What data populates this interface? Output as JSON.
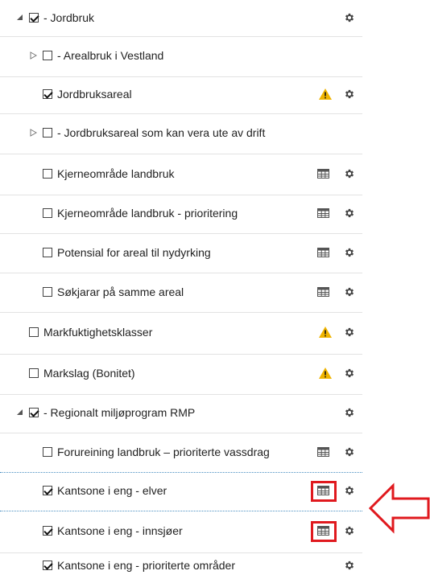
{
  "layers": [
    {
      "label": "- Jordbruk",
      "checked": true,
      "expander": "expanded",
      "table": false,
      "warn": false
    },
    {
      "label": "- Arealbruk i Vestland",
      "checked": false,
      "expander": "collapsed",
      "table": false,
      "warn": false,
      "gear": false
    },
    {
      "label": "Jordbruksareal",
      "checked": true,
      "expander": "none",
      "table": false,
      "warn": true
    },
    {
      "label": "- Jordbruksareal som kan vera ute av drift",
      "checked": false,
      "expander": "collapsed",
      "table": false,
      "warn": false,
      "gear": false
    },
    {
      "label": "Kjerneområde landbruk",
      "checked": false,
      "expander": "none",
      "table": true,
      "warn": false
    },
    {
      "label": "Kjerneområde landbruk - prioritering",
      "checked": false,
      "expander": "none",
      "table": true,
      "warn": false
    },
    {
      "label": "Potensial for areal til nydyrking",
      "checked": false,
      "expander": "none",
      "table": true,
      "warn": false
    },
    {
      "label": "Søkjarar på samme areal",
      "checked": false,
      "expander": "none",
      "table": true,
      "warn": false
    },
    {
      "label": "Markfuktighetsklasser",
      "checked": false,
      "expander": "none",
      "table": false,
      "warn": true
    },
    {
      "label": "Markslag (Bonitet)",
      "checked": false,
      "expander": "none",
      "table": false,
      "warn": true
    },
    {
      "label": "- Regionalt miljøprogram RMP",
      "checked": true,
      "expander": "expanded",
      "table": false,
      "warn": false
    },
    {
      "label": "Forureining landbruk – prioriterte vassdrag",
      "checked": false,
      "expander": "none",
      "table": true,
      "warn": false
    },
    {
      "label": "Kantsone i eng - elver",
      "checked": true,
      "expander": "none",
      "table": true,
      "warn": false,
      "highlight": true
    },
    {
      "label": "Kantsone i eng - innsjøer",
      "checked": true,
      "expander": "none",
      "table": true,
      "warn": false,
      "highlight": true
    },
    {
      "label": "Kantsone i eng - prioriterte områder",
      "checked": true,
      "expander": "none",
      "table": false,
      "warn": false
    }
  ],
  "colors": {
    "warning": "#f0b400",
    "highlight": "#e0191e",
    "gear": "#444444",
    "table": "#555555",
    "separator": "#e2e2e2",
    "drop_indicator": "#4a90c2"
  },
  "icons": {
    "gear": "gear-icon",
    "warning": "warning-icon",
    "table": "table-icon",
    "expand": "triangle-expanded-icon",
    "collapse": "triangle-collapsed-icon",
    "annotation": "red-arrow-left-icon"
  }
}
